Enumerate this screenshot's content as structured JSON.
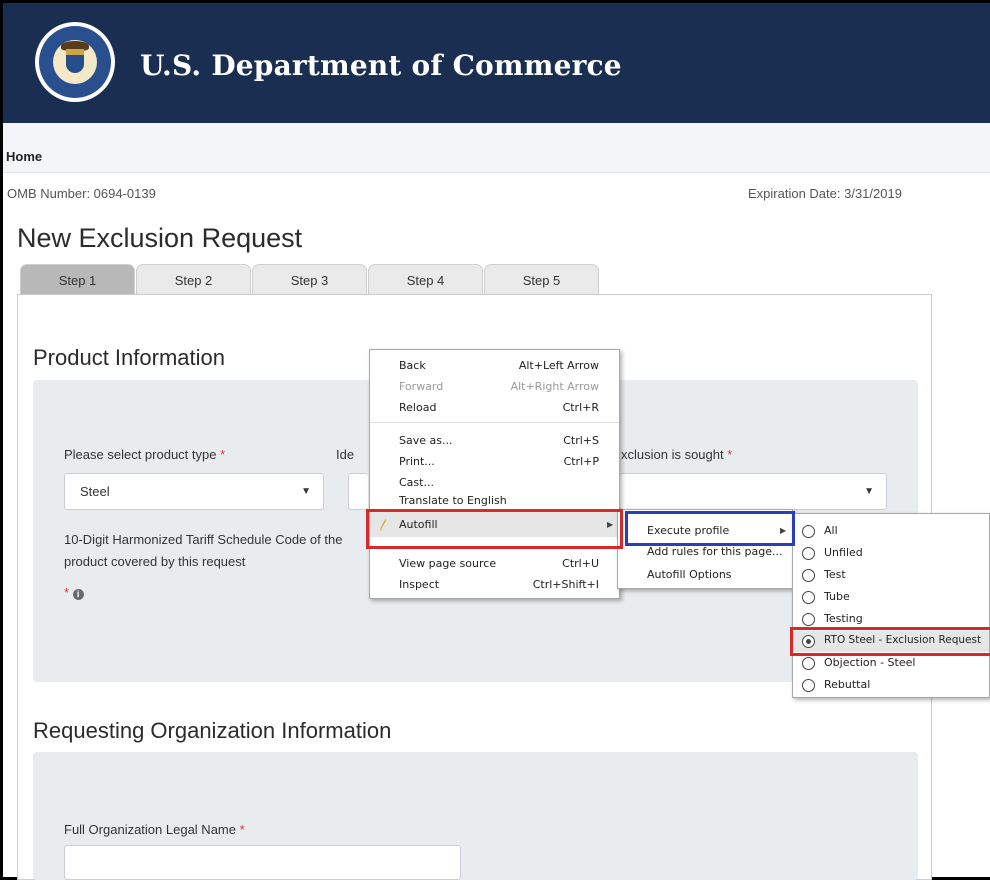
{
  "header": {
    "title": "U.S. Department of Commerce",
    "logo_icon": "department-seal-icon"
  },
  "breadcrumb": {
    "home": "Home"
  },
  "meta": {
    "omb": "OMB Number: 0694-0139",
    "expiration": "Expiration Date: 3/31/2019"
  },
  "page": {
    "title": "New Exclusion Request"
  },
  "tabs": [
    "Step 1",
    "Step 2",
    "Step 3",
    "Step 4",
    "Step 5"
  ],
  "product": {
    "section_title": "Product Information",
    "type_label": "Please select product type",
    "type_value": "Steel",
    "identify_label_partial": "Ide",
    "exclusion_label_partial": "xclusion is sought",
    "hts_label_line1": "10-Digit Harmonized Tariff Schedule Code of the",
    "hts_label_line2": "product covered by this request",
    "required_mark": "*"
  },
  "org": {
    "section_title": "Requesting Organization Information",
    "legal_name_label": "Full Organization Legal Name"
  },
  "context_menu": {
    "back": "Back",
    "back_sc": "Alt+Left Arrow",
    "forward": "Forward",
    "forward_sc": "Alt+Right Arrow",
    "reload": "Reload",
    "reload_sc": "Ctrl+R",
    "save_as": "Save as...",
    "save_as_sc": "Ctrl+S",
    "print": "Print...",
    "print_sc": "Ctrl+P",
    "cast": "Cast...",
    "translate": "Translate to English",
    "autofill": "Autofill",
    "view_source": "View page source",
    "view_source_sc": "Ctrl+U",
    "inspect": "Inspect",
    "inspect_sc": "Ctrl+Shift+I"
  },
  "autofill_menu": {
    "execute_profile": "Execute profile",
    "add_rules": "Add rules for this page...",
    "options": "Autofill Options"
  },
  "profiles": {
    "items": [
      "All",
      "Unfiled",
      "Test",
      "Tube",
      "Testing",
      "RTO Steel - Exclusion Request",
      "Objection - Steel",
      "Rebuttal"
    ],
    "selected": "RTO Steel - Exclusion Request"
  },
  "colors": {
    "header_bg": "#1a2e52",
    "highlight_red": "#d42a2a",
    "highlight_blue": "#2a3eb8"
  }
}
